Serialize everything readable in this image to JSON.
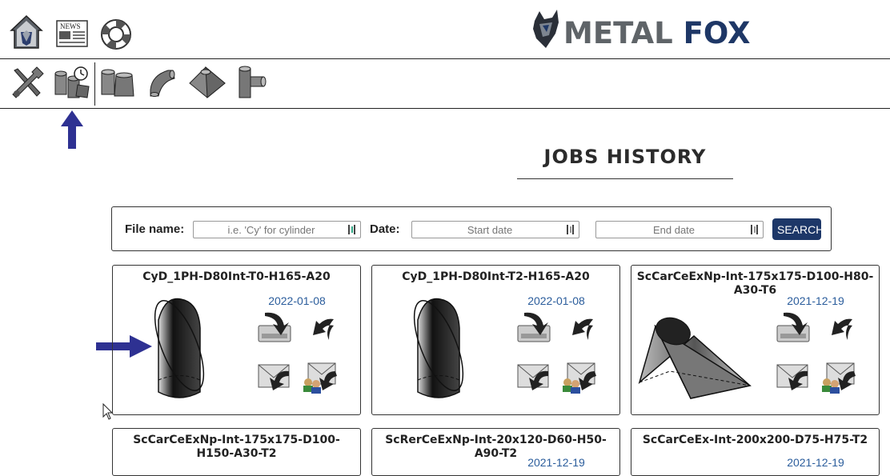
{
  "header": {
    "logo": {
      "word1": "METAL",
      "word2": "FOX"
    },
    "top_icons": [
      "home-icon",
      "news-icon",
      "help-lifebuoy-icon"
    ],
    "tools": [
      "settings-tools-icon",
      "jobs-history-icon",
      "cylinder-shapes-icon",
      "elbow-shape-icon",
      "pyramid-transition-icon",
      "tee-shape-icon"
    ]
  },
  "page": {
    "title": "JOBS HISTORY"
  },
  "search": {
    "file_label": "File name:",
    "file_placeholder": "i.e. 'Cy' for cylinder",
    "date_label": "Date:",
    "start_placeholder": "Start date",
    "end_placeholder": "End date",
    "button": "SEARCH"
  },
  "jobs": [
    {
      "name": "CyD_1PH-D80Int-T0-H165-A20",
      "date": "2022-01-08",
      "shape": "cylinder"
    },
    {
      "name": "CyD_1PH-D80Int-T2-H165-A20",
      "date": "2022-01-08",
      "shape": "cylinder"
    },
    {
      "name": "ScCarCeExNp-Int-175x175-D100-H80-A30-T6",
      "date": "2021-12-19",
      "shape": "transition"
    },
    {
      "name": "ScCarCeExNp-Int-175x175-D100-H150-A30-T2",
      "date": "",
      "shape": "transition"
    },
    {
      "name": "ScRerCeExNp-Int-20x120-D60-H50-A90-T2",
      "date": "2021-12-19",
      "shape": "transition"
    },
    {
      "name": "ScCarCeEx-Int-200x200-D75-H75-T2",
      "date": "2021-12-19",
      "shape": "transition"
    }
  ],
  "actions": [
    "download-icon",
    "reload-icon",
    "email-icon",
    "share-icon"
  ],
  "colors": {
    "accent": "#1d3768",
    "date": "#2b5d9c",
    "arrow": "#2e3192"
  }
}
